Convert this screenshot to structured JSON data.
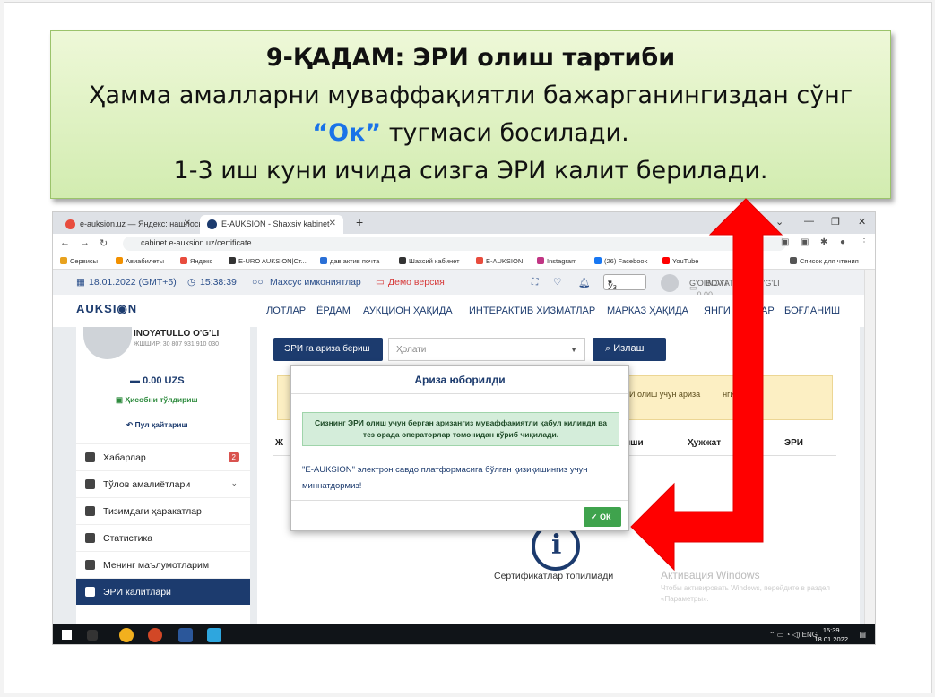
{
  "banner": {
    "title": "9-ҚАДАМ: ЭРИ олиш тартиби",
    "line2": "Ҳамма амалларни муваффақиятли бажарганингиздан сўнг",
    "ok_word": "“Ок”",
    "line3_rest": " тугмаси босилади.",
    "line4": "1-3 иш куни ичида сизга ЭРИ калит берилади."
  },
  "browser": {
    "tabs": [
      {
        "label": "e-auksion.uz — Яндекс: нашлось",
        "favicon_color": "#e84c3d"
      },
      {
        "label": "E-AUKSION - Shaxsiy kabinet",
        "favicon_color": "#1c3b6e"
      }
    ],
    "url": "cabinet.e-auksion.uz/certificate",
    "bookmarks": [
      {
        "label": "Сервисы",
        "color": "#e8a21e"
      },
      {
        "label": "Авиабилеты",
        "color": "#f29100"
      },
      {
        "label": "Яндекс",
        "color": "#e84c3d"
      },
      {
        "label": "E-URO AUKSION|Ст...",
        "color": "#333333"
      },
      {
        "label": "дав актив почта",
        "color": "#2a6fd6"
      },
      {
        "label": "Шахсий кабинет",
        "color": "#333333"
      },
      {
        "label": "E-AUKSION",
        "color": "#e84c3d"
      },
      {
        "label": "Instagram",
        "color": "#c13584"
      },
      {
        "label": "(26) Facebook",
        "color": "#1877f2"
      },
      {
        "label": "YouTube",
        "color": "#ff0000"
      },
      {
        "label": "Список для чтения",
        "color": "#555555"
      }
    ]
  },
  "site": {
    "date": "18.01.2022 (GMT+5)",
    "time": "15:38:39",
    "accessibility": "Махсус имкониятлар",
    "demo": "Демо версия",
    "lang": "Ўз",
    "notif_count": "2",
    "user_name_short": "G'OIBOV I",
    "user_name_rest": "INOYATULLO O'G'LI",
    "user_balance_short": "0.00",
    "logo": "AUKSI◉N",
    "menu": [
      "ЛОТЛАР",
      "ЁРДАМ",
      "АУКЦИОН ҲАҚИДА",
      "ИНТЕРАКТИВ ХИЗМАТЛАР",
      "МАРКАЗ ҲАҚИДА",
      "ЯНГИ",
      "АР",
      "БОҒЛАНИШ"
    ],
    "profile": {
      "name": "INOYATULLO O'G'LI",
      "inn": "ЖШШИР: 30 807 931 910 030",
      "balance": "0.00 UZS",
      "topup": "Ҳисобни тўлдириш",
      "refund": "Пул қайтариш"
    },
    "sidebar": [
      {
        "label": "Хабарлар",
        "badge": "2"
      },
      {
        "label": "Тўлов амалиётлари",
        "badge": ""
      },
      {
        "label": "Тизимдаги ҳаракатлар",
        "badge": ""
      },
      {
        "label": "Статистика",
        "badge": ""
      },
      {
        "label": "Менинг маълумотларим",
        "badge": ""
      },
      {
        "label": "ЭРИ калитлари",
        "badge": ""
      }
    ],
    "content": {
      "apply_button": "ЭРИ га ариза бериш",
      "status_placeholder": "Ҳолати",
      "search_button": "Излаш",
      "warning_fragment": "и ЭРИ олиш учун ариза",
      "warning_tail": "нгиз",
      "table_headers": [
        "Ж",
        "иши",
        "Ҳужжат",
        "ЭРИ"
      ],
      "empty_text": "Сертификатлар топилмади",
      "activation": "Активация Windows",
      "activation_sub": "Чтобы активировать Windows, перейдите в раздел «Параметры»."
    },
    "modal": {
      "title": "Ариза юборилди",
      "alert": "Сизнинг ЭРИ олиш учун берган аризангиз муваффақиятли қабул қилинди ва тез орада операторлар томонидан кўриб чиқилади.",
      "body": "\"E-AUKSION\" электрон савдо платформасига бўлган қизиқишингиз учун миннатдормиз!",
      "ok": "ОК"
    },
    "taskbar": {
      "lang": "ENG",
      "time": "15:39",
      "date": "18.01.2022"
    }
  },
  "colors": {
    "brand": "#1c3b6e",
    "arrow": "#ff0000",
    "ok_button": "#3fa34d",
    "banner_top": "#eef8d8",
    "banner_bottom": "#d2ecb0"
  }
}
